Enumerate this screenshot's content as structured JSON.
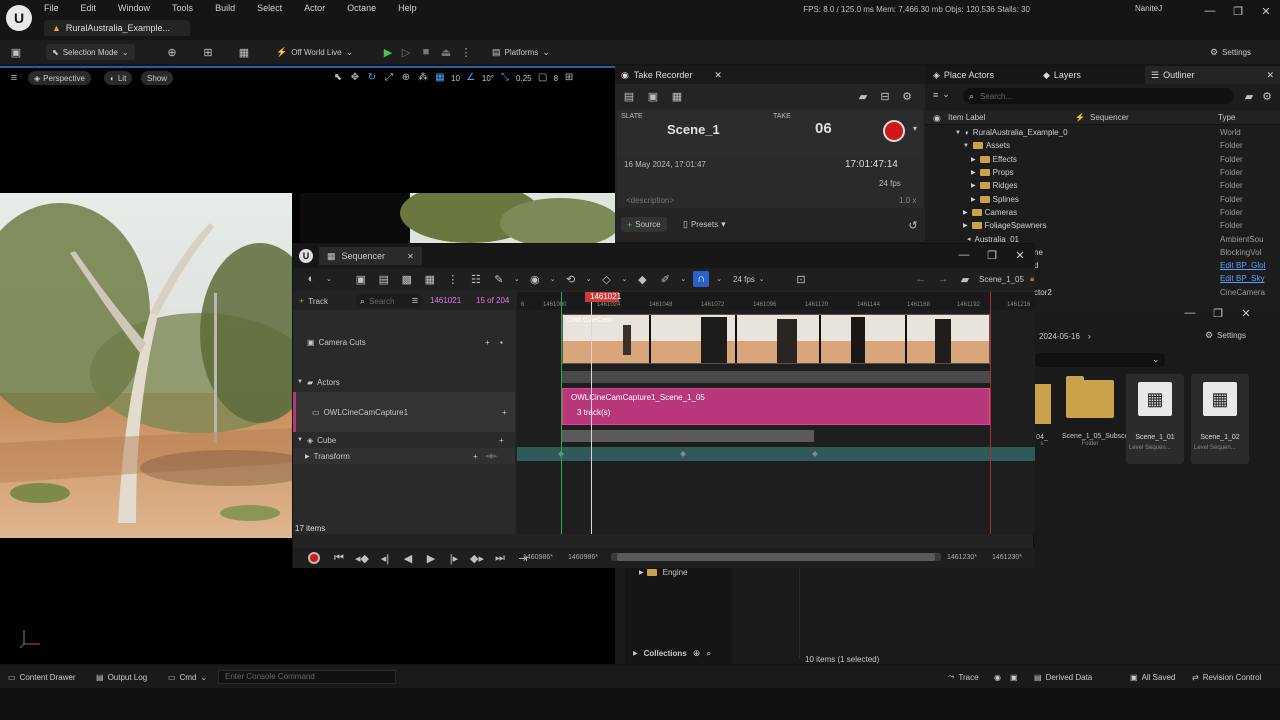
{
  "app": {
    "menu": [
      "File",
      "Edit",
      "Window",
      "Tools",
      "Build",
      "Select",
      "Actor",
      "Octane",
      "Help"
    ],
    "project_tab": "RuralAustralia_Example...",
    "stats": "FPS: 8.0  /  125.0 ms  Mem: 7,466.30 mb  Objs: 120,536  Stalls: 30",
    "user": "NaniteJ"
  },
  "toolbar": {
    "selection_mode": "Selection Mode",
    "world": "Off World Live",
    "platforms": "Platforms",
    "settings": "Settings"
  },
  "viewport": {
    "perspective": "Perspective",
    "lit": "Lit",
    "show": "Show",
    "grid": "10",
    "angle": "10°",
    "scale": "0.25",
    "cams": "8"
  },
  "take_recorder": {
    "tab": "Take Recorder",
    "slate_label": "SLATE",
    "slate": "Scene_1",
    "take_label": "TAKE",
    "take": "06",
    "date": "16 May 2024, 17:01:47",
    "timecode": "17:01:47:14",
    "fps": "24 fps",
    "description": "<description>",
    "rate": "1.0 x",
    "source": "Source",
    "presets": "Presets"
  },
  "outliner": {
    "tabs": [
      "Place Actors",
      "Layers",
      "Outliner"
    ],
    "search": "Search...",
    "col_label": "Item Label",
    "col_seq": "Sequencer",
    "col_type": "Type",
    "rows": [
      {
        "label": "RuralAustralia_Example_0",
        "type": "World",
        "indent": 0
      },
      {
        "label": "Assets",
        "type": "Folder",
        "indent": 1
      },
      {
        "label": "Effects",
        "type": "Folder",
        "indent": 2
      },
      {
        "label": "Props",
        "type": "Folder",
        "indent": 2
      },
      {
        "label": "Ridges",
        "type": "Folder",
        "indent": 2
      },
      {
        "label": "Splines",
        "type": "Folder",
        "indent": 2
      },
      {
        "label": "Cameras",
        "type": "Folder",
        "indent": 1
      },
      {
        "label": "FoliageSpawners",
        "type": "Folder",
        "indent": 1
      },
      {
        "label": "Australia_01",
        "type": "AmbientSou",
        "indent": 1
      }
    ],
    "extra_types": [
      "BlockingVol",
      "Edit BP_Glol",
      "Edit BP_Sky",
      "CineCamera"
    ],
    "extra_labels": [
      "ne",
      "d",
      "ctor2"
    ]
  },
  "content_browser": {
    "path": "2024-05-16",
    "settings": "Settings",
    "assets": [
      {
        "name": "04_",
        "sub": "s",
        "kind": "folder"
      },
      {
        "name": "Scene_1_05_Subscenes",
        "sub": "Folder",
        "kind": "folder"
      },
      {
        "name": "Scene_1_01",
        "sub": "Level Sequen...",
        "kind": "seq"
      },
      {
        "name": "Scene_1_02",
        "sub": "Level Sequen...",
        "kind": "seq"
      }
    ],
    "engine": "Engine",
    "collections": "Collections",
    "count": "10 items (1 selected)"
  },
  "sequencer": {
    "title": "Sequencer",
    "fps": "24 fps",
    "scene": "Scene_1_05",
    "track_btn": "Track",
    "search": "Search",
    "frame": "1461021",
    "of": "15 of 204",
    "ruler": [
      "6",
      "1461000",
      "1461024",
      "1461048",
      "1461072",
      "1461096",
      "1461120",
      "1461144",
      "1461168",
      "1461192",
      "1461216"
    ],
    "tracks": {
      "camera_cuts": "Camera Cuts",
      "actors": "Actors",
      "owl": "OWLCineCamCapture1",
      "cube": "Cube",
      "transform": "Transform"
    },
    "clip": {
      "name": "OWLCineCamCapture1_Scene_1_05",
      "sub": "3 track(s)",
      "cam": "OWLCineCam"
    },
    "items": "17 items",
    "range_start": "1460986*",
    "range_start2": "1460986*",
    "range_end": "1461230*",
    "range_end2": "1461230*"
  },
  "statusbar": {
    "content_drawer": "Content Drawer",
    "output_log": "Output Log",
    "cmd": "Cmd",
    "console": "Enter Console Command",
    "trace": "Trace",
    "derived": "Derived Data",
    "saved": "All Saved",
    "revision": "Revision Control"
  },
  "colors": {
    "accent": "#2b5aa8",
    "clip": "#b8377a",
    "record": "#d01818",
    "playhead": "#d8d8d8"
  }
}
